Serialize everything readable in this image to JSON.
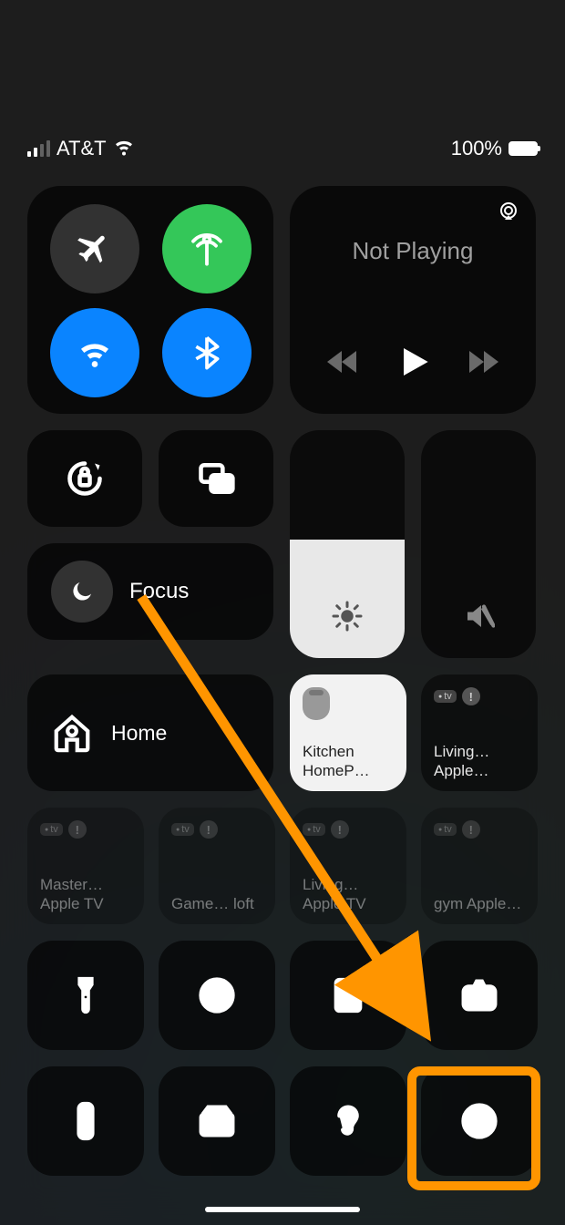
{
  "status": {
    "carrier": "AT&T",
    "battery_pct": "100%"
  },
  "music": {
    "title": "Not Playing"
  },
  "focus": {
    "label": "Focus"
  },
  "home": {
    "label": "Home"
  },
  "brightness": {
    "pct": 52
  },
  "volume": {
    "pct": 0
  },
  "tv_row1": [
    {
      "label": "Kitchen HomeP…",
      "type": "homepod"
    },
    {
      "label": "Living… Apple…",
      "type": "atv"
    }
  ],
  "tv_row2": [
    {
      "label": "Master… Apple TV",
      "type": "atv"
    },
    {
      "label": "Game… loft",
      "type": "atv"
    },
    {
      "label": "Living… Apple TV",
      "type": "atv"
    },
    {
      "label": "gym Apple…",
      "type": "atv"
    }
  ],
  "annotation": {
    "color": "#FF9500"
  }
}
